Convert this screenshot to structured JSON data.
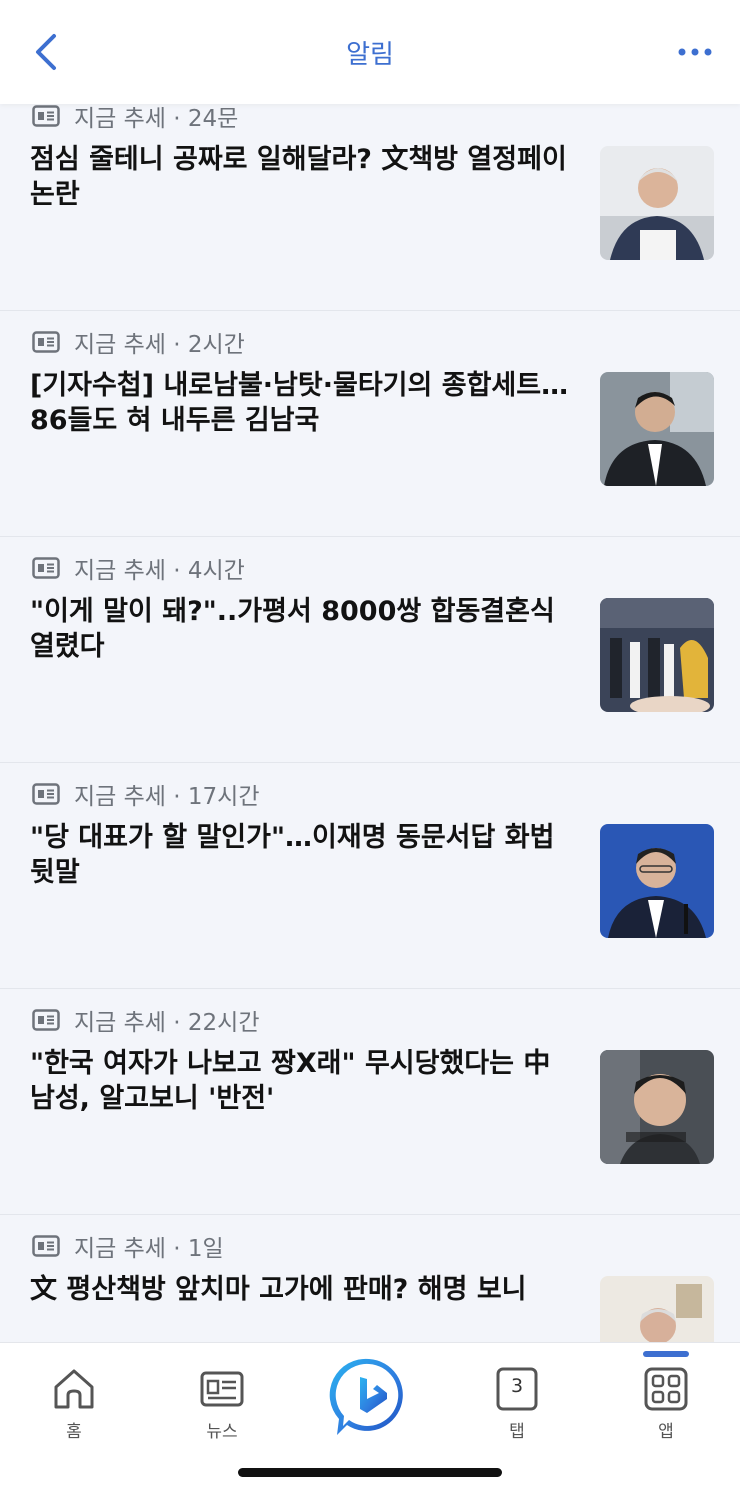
{
  "header": {
    "title": "알림"
  },
  "feed": [
    {
      "source": "지금 추세",
      "time": "24문",
      "headline": "점심 줄테니 공짜로 일해달라? 文책방 열정페이 논란"
    },
    {
      "source": "지금 추세",
      "time": "2시간",
      "headline": "[기자수첩] 내로남불·남탓·물타기의 종합세트… 86들도 혀 내두른 김남국"
    },
    {
      "source": "지금 추세",
      "time": "4시간",
      "headline": "\"이게 말이 돼?\"..가평서 8000쌍 합동결혼식 열렸다"
    },
    {
      "source": "지금 추세",
      "time": "17시간",
      "headline": "\"당 대표가 할 말인가\"…이재명 동문서답 화법 뒷말"
    },
    {
      "source": "지금 추세",
      "time": "22시간",
      "headline": "\"한국 여자가 나보고 짱X래\" 무시당했다는 中남성, 알고보니 '반전'"
    },
    {
      "source": "지금 추세",
      "time": "1일",
      "headline": "文 평산책방 앞치마 고가에 판매? 해명 보니"
    }
  ],
  "nav": {
    "home": "홈",
    "news": "뉴스",
    "tabs": "탭",
    "tab_count": "3",
    "apps": "앱"
  },
  "colors": {
    "accent": "#3d6fd0",
    "background": "#f3f5fa"
  }
}
